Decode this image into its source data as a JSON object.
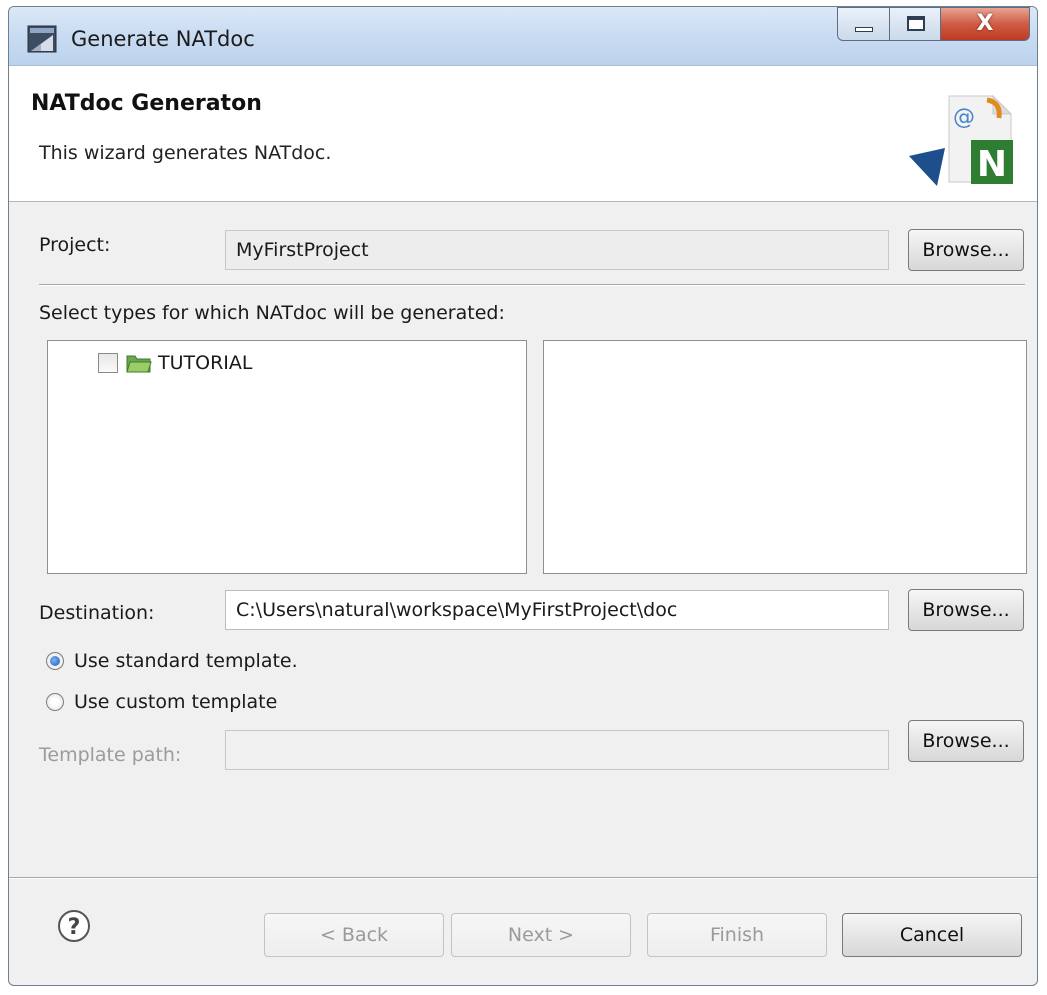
{
  "window": {
    "title": "Generate NATdoc",
    "close_glyph": "X",
    "controls": [
      "minimize-icon",
      "maximize-icon",
      "close-icon"
    ]
  },
  "header": {
    "title": "NATdoc Generaton",
    "subtitle": "This wizard generates NATdoc.",
    "image_icon": "natdoc-wizard-icon",
    "image_letter": "N",
    "image_at": "@"
  },
  "form": {
    "project_label": "Project:",
    "project_value": "MyFirstProject",
    "select_types_label": "Select types for which NATdoc will be generated:",
    "tree_items": [
      {
        "label": "TUTORIAL",
        "checked": false,
        "icon": "folder-icon"
      }
    ],
    "destination_label": "Destination:",
    "destination_value": "C:\\Users\\natural\\workspace\\MyFirstProject\\doc",
    "radio_standard": "Use standard template.",
    "radio_custom": "Use custom template",
    "selected_radio": "standard",
    "template_path_label": "Template path:",
    "template_path_value": "",
    "browse_label": "Browse..."
  },
  "footer": {
    "help_icon": "help-icon",
    "back_label": "< Back",
    "next_label": "Next >",
    "finish_label": "Finish",
    "cancel_label": "Cancel"
  },
  "colors": {
    "titlebar": "#c7daf1",
    "close_button": "#c13a22",
    "dialog_bg": "#f0f0f0",
    "radio_selected": "#1d5bb8",
    "folder": "#6aa84f"
  }
}
